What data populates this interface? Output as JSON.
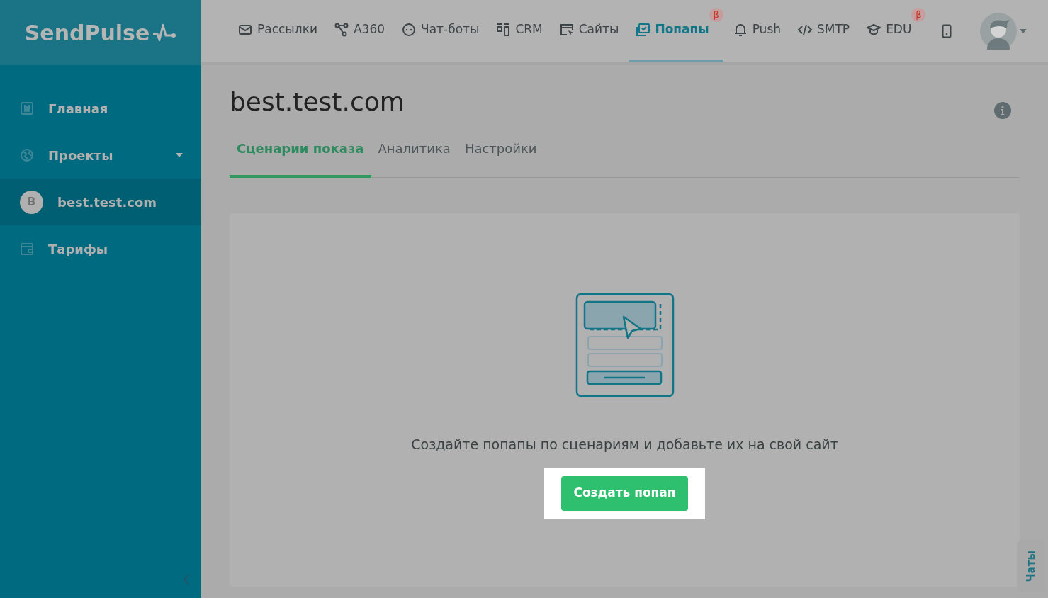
{
  "logo": {
    "text": "SendPulse"
  },
  "nav": [
    {
      "label": "Рассылки",
      "kind": "mail",
      "selected": false
    },
    {
      "label": "A360",
      "kind": "flow",
      "selected": false
    },
    {
      "label": "Чат-боты",
      "kind": "chat",
      "selected": false
    },
    {
      "label": "CRM",
      "kind": "crm",
      "selected": false
    },
    {
      "label": "Сайты",
      "kind": "site",
      "selected": false
    },
    {
      "label": "Попапы",
      "kind": "popup",
      "selected": true,
      "badge": "β"
    },
    {
      "label": "Push",
      "kind": "bell",
      "selected": false
    },
    {
      "label": "SMTP",
      "kind": "code",
      "selected": false
    },
    {
      "label": "EDU",
      "kind": "cap",
      "selected": false,
      "badge": "β"
    }
  ],
  "sidebar": {
    "items": [
      {
        "label": "Главная",
        "kind": "home",
        "selected": false
      },
      {
        "label": "Проекты",
        "kind": "globe",
        "selected": false,
        "expanded": false
      },
      {
        "label": "best.test.com",
        "kind": "avatar",
        "avatar_letter": "B",
        "selected": true
      },
      {
        "label": "Тарифы",
        "kind": "wallet",
        "selected": false
      }
    ]
  },
  "page": {
    "title": "best.test.com",
    "tabs": [
      {
        "label": "Сценарии показа",
        "selected": true
      },
      {
        "label": "Аналитика",
        "selected": false
      },
      {
        "label": "Настройки",
        "selected": false
      }
    ],
    "empty_state": {
      "text": "Создайте попапы по сценариям и добавьте их на свой сайт",
      "button": "Создать попап"
    }
  },
  "chat_tab": "Чаты"
}
